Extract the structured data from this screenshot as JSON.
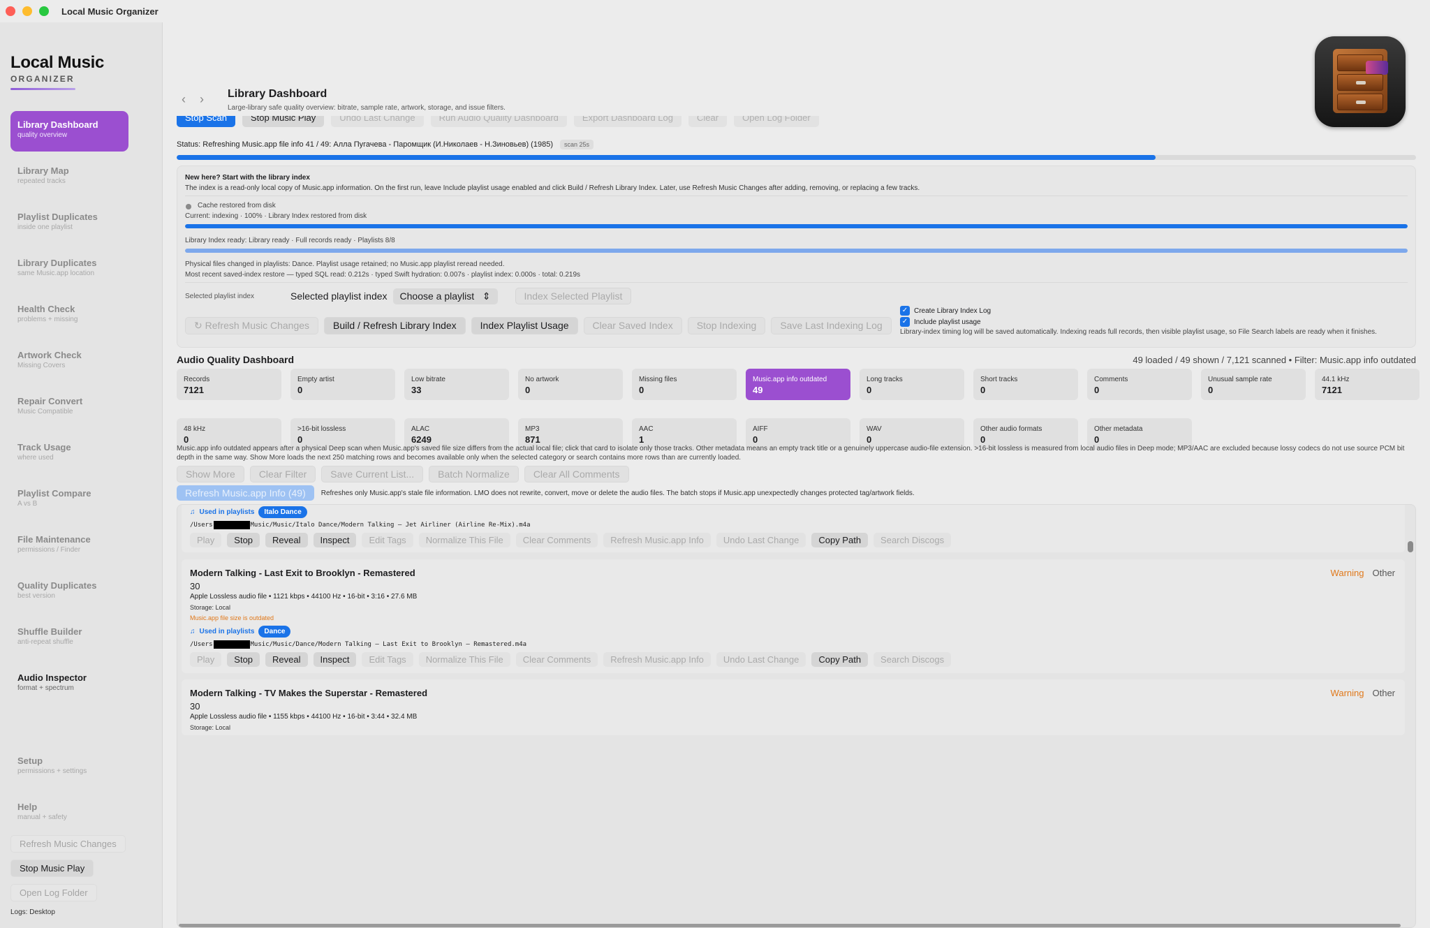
{
  "window": {
    "title": "Local Music Organizer"
  },
  "brand": {
    "name": "Local Music",
    "sub": "ORGANIZER"
  },
  "sidebar": {
    "items": [
      {
        "label": "Library Dashboard",
        "sub": "quality overview"
      },
      {
        "label": "Library Map",
        "sub": "repeated tracks"
      },
      {
        "label": "Playlist Duplicates",
        "sub": "inside one playlist"
      },
      {
        "label": "Library Duplicates",
        "sub": "same Music.app location"
      },
      {
        "label": "Health Check",
        "sub": "problems + missing"
      },
      {
        "label": "Artwork Check",
        "sub": "Missing Covers"
      },
      {
        "label": "Repair Convert",
        "sub": "Music Compatible"
      },
      {
        "label": "Track Usage",
        "sub": "where used"
      },
      {
        "label": "Playlist Compare",
        "sub": "A vs B"
      },
      {
        "label": "File Maintenance",
        "sub": "permissions / Finder"
      },
      {
        "label": "Quality Duplicates",
        "sub": "best version"
      },
      {
        "label": "Shuffle Builder",
        "sub": "anti-repeat shuffle"
      },
      {
        "label": "Audio Inspector",
        "sub": "format + spectrum"
      }
    ],
    "setup": {
      "label": "Setup",
      "sub": "permissions + settings"
    },
    "help": {
      "label": "Help",
      "sub": "manual + safety"
    },
    "buttons": {
      "refresh": "Refresh Music Changes",
      "stop": "Stop Music Play",
      "open_log": "Open Log Folder"
    },
    "logs": "Logs: Desktop"
  },
  "header": {
    "title": "Library Dashboard",
    "subtitle": "Large-library safe quality overview: bitrate, sample rate, artwork, storage, and issue filters."
  },
  "toolbar": {
    "buttons": [
      "Stop Scan",
      "Stop Music Play",
      "Undo Last Change",
      "Run Audio Quality Dashboard",
      "Export Dashboard Log",
      "Clear",
      "Open Log Folder"
    ]
  },
  "status": {
    "text": "Status: Refreshing Music.app file info 41 / 49: Алла Пугачева - Паромщик (И.Николаев - Н.Зиновьев) (1985)",
    "badge": "scan 25s",
    "progress": 0.79
  },
  "index_panel": {
    "title": "New here? Start with the library index",
    "desc": "The index is a read-only local copy of Music.app information. On the first run, leave Include playlist usage enabled and click Build / Refresh Library Index. Later, use Refresh Music Changes after adding, removing, or replacing a few tracks.",
    "cache": "Cache restored from disk",
    "current": "Current: indexing · 100% · Library Index restored from disk",
    "progress1": 1.0,
    "ready": "Library Index ready: Library ready · Full records ready · Playlists 8/8",
    "progress2": 1.0,
    "physical": "Physical files changed in playlists: Dance. Playlist usage retained; no Music.app playlist reread needed.",
    "recent": "Most recent saved-index restore — typed SQL read: 0.212s · typed Swift hydration: 0.007s · playlist index: 0.000s · total: 0.219s",
    "sel_small": "Selected playlist index",
    "sel_big": "Selected playlist index",
    "select_value": "Choose a playlist",
    "index_selected": "Index Selected Playlist",
    "buttons": [
      "Refresh Music Changes",
      "Build / Refresh Library Index",
      "Index Playlist Usage",
      "Clear Saved Index",
      "Stop Indexing",
      "Save Last Indexing Log"
    ],
    "check1": "Create Library Index Log",
    "check2": "Include playlist usage",
    "check_note": "Library-index timing log will be saved automatically. Indexing reads full records, then visible playlist usage, so File Search labels are ready when it finishes."
  },
  "dashboard": {
    "title": "Audio Quality Dashboard",
    "summary": "49 loaded / 49 shown / 7,121 scanned • Filter: Music.app info outdated",
    "cards_row1": [
      {
        "k": "Records",
        "v": "7121"
      },
      {
        "k": "Empty artist",
        "v": "0"
      },
      {
        "k": "Low bitrate",
        "v": "33"
      },
      {
        "k": "No artwork",
        "v": "0"
      },
      {
        "k": "Missing files",
        "v": "0"
      },
      {
        "k": "Music.app info outdated",
        "v": "49"
      },
      {
        "k": "Long tracks",
        "v": "0"
      },
      {
        "k": "Short tracks",
        "v": "0"
      },
      {
        "k": "Comments",
        "v": "0"
      },
      {
        "k": "Unusual sample rate",
        "v": "0"
      },
      {
        "k": "44.1 kHz",
        "v": "7121"
      }
    ],
    "cards_row2": [
      {
        "k": "48 kHz",
        "v": "0"
      },
      {
        "k": ">16-bit lossless",
        "v": "0"
      },
      {
        "k": "ALAC",
        "v": "6249"
      },
      {
        "k": "MP3",
        "v": "871"
      },
      {
        "k": "AAC",
        "v": "1"
      },
      {
        "k": "AIFF",
        "v": "0"
      },
      {
        "k": "WAV",
        "v": "0"
      },
      {
        "k": "Other audio formats",
        "v": "0"
      },
      {
        "k": "Other metadata",
        "v": "0"
      }
    ],
    "note": "Music.app info outdated appears after a physical Deep scan when Music.app's saved file size differs from the actual local file; click that card to isolate only those tracks. Other metadata means an empty track title or a genuinely uppercase audio-file extension. >16-bit lossless is measured from local audio files in Deep mode; MP3/AAC are excluded because lossy codecs do not use source PCM bit depth in the same way. Show More loads the next 250 matching rows and becomes available only when the selected category or search contains more rows than are currently loaded.",
    "buttons": [
      "Show More",
      "Clear Filter",
      "Save Current List...",
      "Batch Normalize",
      "Clear All Comments"
    ],
    "refresh_btn": "Refresh Music.app Info (49)",
    "refresh_note": "Refreshes only Music.app's stale file information. LMO does not rewrite, convert, move or delete the audio files. The batch stops if Music.app unexpectedly changes protected tag/artwork fields."
  },
  "tracks": [
    {
      "used": "Used in playlists",
      "tag": "Italo Dance",
      "path_pre": "/Users",
      "path_post": "Music/Music/Italo Dance/Modern Talking – Jet Airliner (Airline Re-Mix).m4a"
    },
    {
      "title": "Modern Talking - Last Exit to Brooklyn - Remastered",
      "num": "30",
      "meta": "Apple Lossless audio file • 1121 kbps • 44100 Hz • 16-bit • 3:16 • 27.6 MB",
      "storage": "Storage: Local",
      "warnline": "Music.app file size is outdated",
      "used": "Used in playlists",
      "tag": "Dance",
      "path_pre": "/Users",
      "path_post": "Music/Music/Dance/Modern Talking – Last Exit to Brooklyn – Remastered.m4a",
      "flag_warn": "Warning",
      "flag_other": "Other"
    },
    {
      "title": "Modern Talking - TV Makes the Superstar - Remastered",
      "num": "30",
      "meta": "Apple Lossless audio file • 1155 kbps • 44100 Hz • 16-bit • 3:44 • 32.4 MB",
      "storage": "Storage: Local",
      "flag_warn": "Warning",
      "flag_other": "Other"
    }
  ],
  "track_actions": [
    "Play",
    "Stop",
    "Reveal",
    "Inspect",
    "Edit Tags",
    "Normalize This File",
    "Clear Comments",
    "Refresh Music.app Info",
    "Undo Last Change",
    "Copy Path",
    "Search Discogs"
  ]
}
